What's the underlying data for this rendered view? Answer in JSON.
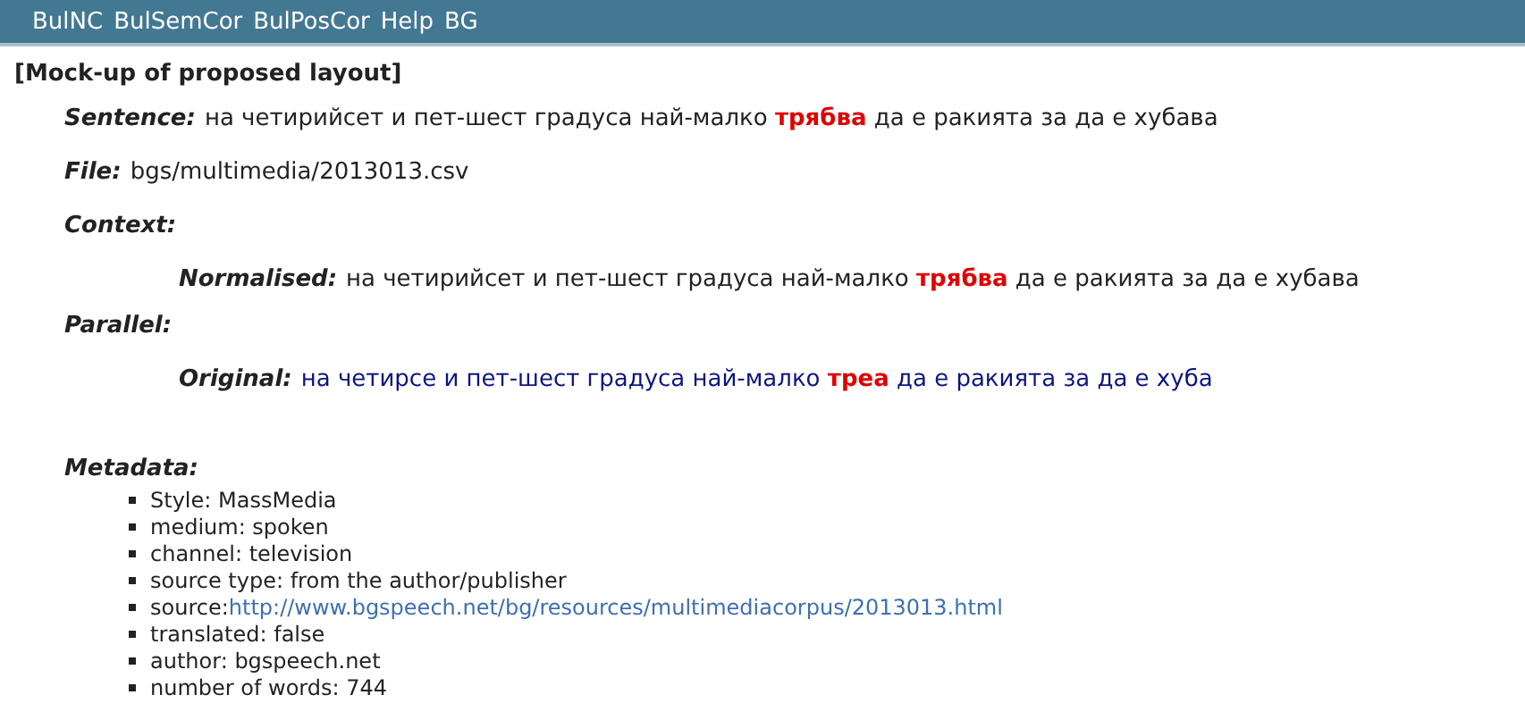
{
  "menu": [
    "BulNC",
    "BulSemCor",
    "BulPosCor",
    "Help",
    "BG"
  ],
  "heading": "[Mock-up of proposed layout]",
  "fields": [
    {
      "kind": "entry",
      "label": "Sentence:",
      "value": "на четирийсет и пет-шест градуса най-малко **трябва** да е ракията за да е хубава"
    },
    {
      "kind": "entry",
      "label": "File:",
      "value": "bgs/multimedia/2013013.csv"
    },
    {
      "kind": "section",
      "label": "Context:"
    },
    {
      "kind": "nested",
      "label": "Normalised:",
      "value": "на четирийсет и пет-шест градуса най-малко **трябва** да е ракията за да е хубава"
    },
    {
      "kind": "section",
      "label": "Parallel:"
    },
    {
      "kind": "original",
      "label": "Original:",
      "value": "на четирсе и пет-шест градуса най-малко **треа** да е ракията за да е хуба"
    }
  ],
  "metadata": {
    "label": "Metadata:",
    "items": [
      {
        "text": "Style: MassMedia"
      },
      {
        "text": "medium: spoken"
      },
      {
        "text": "channel: television"
      },
      {
        "text": "source type: from the author/publisher"
      },
      {
        "text": "source:",
        "link": "http://www.bgspeech.net/bg/resources/multimediacorpus/2013013.html"
      },
      {
        "text": "translated: false"
      },
      {
        "text": "author: bgspeech.net"
      },
      {
        "text": "number of words: 744"
      }
    ]
  }
}
